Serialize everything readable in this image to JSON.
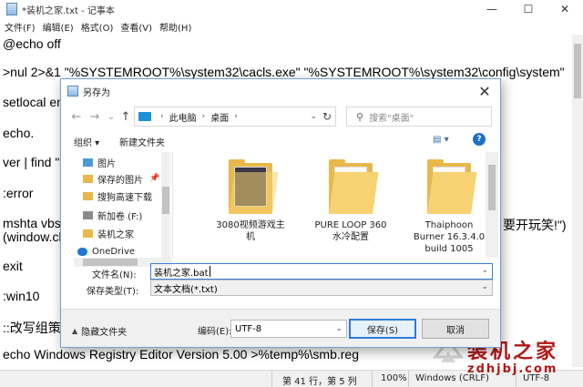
{
  "notepad": {
    "title": "*装机之家.txt - 记事本",
    "window_controls": [
      "—",
      "☐",
      "✕"
    ],
    "menu": [
      "文件(F)",
      "编辑(E)",
      "格式(O)",
      "查看(V)",
      "帮助(H)"
    ],
    "lines": [
      "@echo off",
      ">nul 2>&1 \"%SYSTEMROOT%\\system32\\cacls.exe\" \"%SYSTEMROOT%\\system32\\config\\system\"",
      "setlocal en",
      "echo.",
      "ver | find \"",
      ":error",
      "mshta vbsc",
      "(window.cl",
      "exit",
      ":win10",
      "::改写组策略",
      "echo Windows Registry Editor Version 5.00 >%temp%\\smb.reg"
    ],
    "right_fragment": "要开玩笑!\")",
    "status": {
      "position": "第 41 行，第 5 列",
      "zoom": "100%",
      "line_ending": "Windows (CRLF)",
      "encoding": "UTF-8"
    }
  },
  "watermark": {
    "brand_cn": "装机之家",
    "brand_en": "zdhjbj.com"
  },
  "dialog": {
    "title": "另存为",
    "close": "✕",
    "nav": {
      "back": "←",
      "forward": "→",
      "dropdown": "⌄",
      "up": "↑",
      "path": [
        "此电脑",
        "桌面"
      ],
      "search_placeholder": "搜索\"桌面\""
    },
    "toolbar": {
      "organize": "组织 ▾",
      "new_folder": "新建文件夹",
      "view": "▤ ▾",
      "help": "?"
    },
    "nav_pane": [
      {
        "label": "图片",
        "color": "#4a9ad6",
        "pinned": false
      },
      {
        "label": "保存的图片",
        "color": "#e8b94a",
        "pinned": true
      },
      {
        "label": "搜狗高速下载",
        "color": "#e8b94a",
        "pinned": false
      },
      {
        "label": "新加卷 (F:)",
        "color": "#8a8a8a",
        "pinned": false
      },
      {
        "label": "装机之家",
        "color": "#e8b94a",
        "pinned": false
      },
      {
        "label": "OneDrive",
        "color": "#1e78d2",
        "pinned": false
      }
    ],
    "files": [
      {
        "name": "3080视频游戏主机",
        "kind": "photo"
      },
      {
        "name": "PURE LOOP 360水冷配置",
        "kind": "doc"
      },
      {
        "name": "Thaiphoon Burner 16.3.4.0 build 1005",
        "kind": "doc"
      }
    ],
    "filename_label": "文件名(N):",
    "filename_value": "装机之家.bat",
    "filetype_label": "保存类型(T):",
    "filetype_value": "文本文档(*.txt)",
    "hide_folders": "隐藏文件夹",
    "encoding_label": "编码(E):",
    "encoding_value": "UTF-8",
    "save_button": "保存(S)",
    "cancel_button": "取消"
  }
}
